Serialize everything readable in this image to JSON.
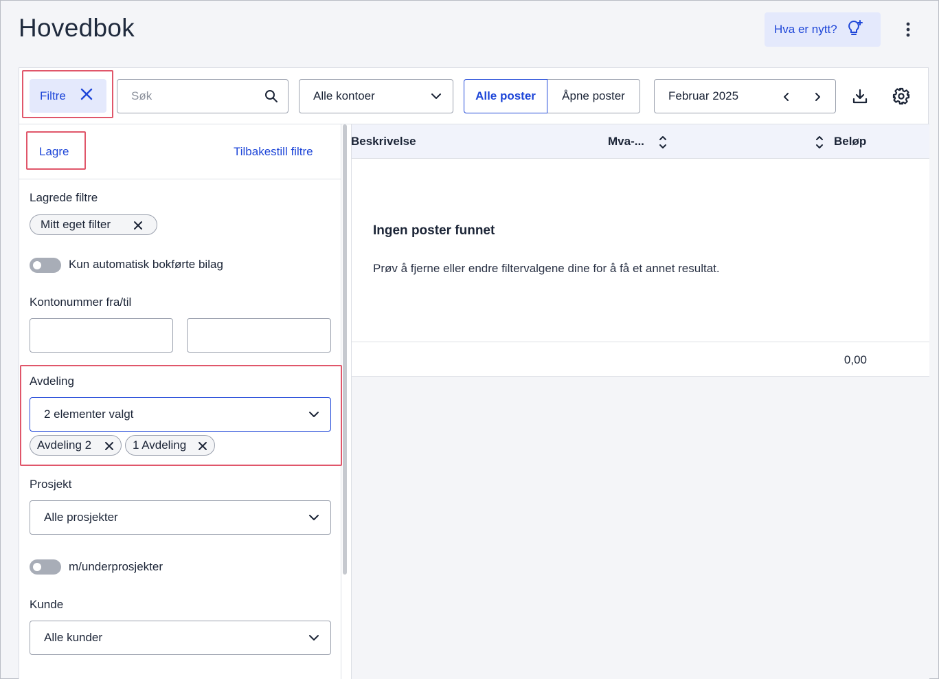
{
  "header": {
    "title": "Hovedbok",
    "whats_new_label": "Hva er nytt?",
    "icons": {
      "whats_new": "lightbulb-sparkle-icon",
      "more": "more-vertical-icon"
    }
  },
  "toolbar": {
    "filter_label": "Filtre",
    "search_placeholder": "Søk",
    "search_value": "",
    "accounts_select": "Alle kontoer",
    "segment": {
      "all": "Alle poster",
      "open": "Åpne poster",
      "selected": "all"
    },
    "period": "Februar 2025",
    "icons": {
      "download": "download-icon",
      "settings": "gear-icon"
    }
  },
  "filters": {
    "save_label": "Lagre",
    "reset_label": "Tilbakestill filtre",
    "saved_filters_label": "Lagrede filtre",
    "saved_filters": [
      "Mitt eget filter"
    ],
    "auto_posted_label": "Kun automatisk bokførte bilag",
    "auto_posted_on": false,
    "account_range_label": "Kontonummer fra/til",
    "account_from": "",
    "account_to": "",
    "department_label": "Avdeling",
    "department_select": "2 elementer valgt",
    "department_chips": [
      "Avdeling 2",
      "1 Avdeling"
    ],
    "project_label": "Prosjekt",
    "project_select": "Alle prosjekter",
    "subprojects_label": "m/underprosjekter",
    "subprojects_on": false,
    "customer_label": "Kunde",
    "customer_select": "Alle kunder"
  },
  "table": {
    "columns": [
      "Beskrivelse",
      "Mva-...",
      "Beløp"
    ],
    "empty_title": "Ingen poster funnet",
    "empty_text": "Prøv å fjerne eller endre filtervalgene dine for å få et annet resultat.",
    "total": "0,00"
  },
  "colors": {
    "accent": "#1e46d8",
    "accent_bg": "#e4e9fc",
    "highlight": "#e0566a",
    "page_bg": "#f4f5f8"
  }
}
